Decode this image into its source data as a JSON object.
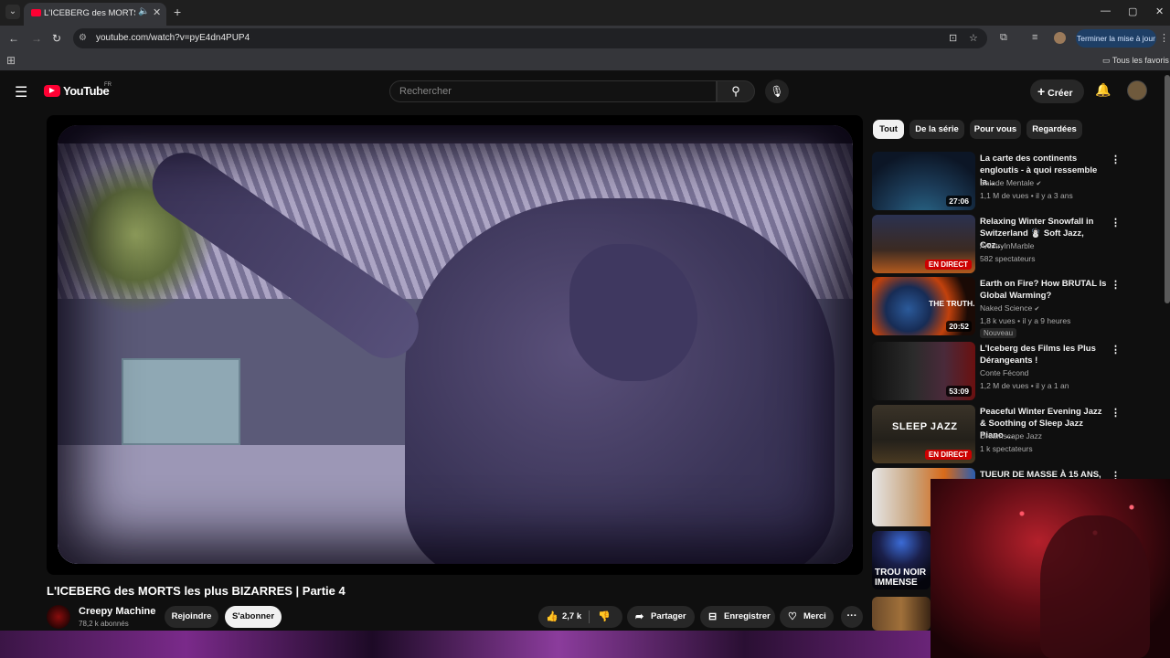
{
  "browser": {
    "tab_title": "L'ICEBERG des MORTS les p",
    "url": "youtube.com/watch?v=pyE4dn4PUP4",
    "update_button": "Terminer la mise à jour",
    "bookmarks_folder": "Tous les favoris"
  },
  "header": {
    "wordmark": "YouTube",
    "country": "FR",
    "search_placeholder": "Rechercher",
    "create_label": "Créer"
  },
  "video": {
    "title": "L'ICEBERG des MORTS les plus BIZARRES | Partie 4",
    "channel": "Creepy Machine",
    "subscribers": "78,2 k abonnés",
    "join_label": "Rejoindre",
    "subscribe_label": "S'abonner",
    "likes": "2,7 k",
    "share_label": "Partager",
    "save_label": "Enregistrer",
    "thanks_label": "Merci"
  },
  "chips": [
    "Tout",
    "De la série",
    "Pour vous",
    "Regardées"
  ],
  "recommendations": [
    {
      "title": "La carte des continents engloutis - à quoi ressemble la...",
      "channel": "Balade Mentale",
      "verified": true,
      "meta": "1,1 M de vues • il y a 3 ans",
      "duration": "27:06"
    },
    {
      "title": "Relaxing Winter Snowfall in Switzerland ☃️ Soft Jazz, Coz...",
      "channel": "ArtistryInMarble",
      "verified": false,
      "meta": "582 spectateurs",
      "live": "EN DIRECT"
    },
    {
      "title": "Earth on Fire? How BRUTAL Is Global Warming?",
      "channel": "Naked Science",
      "verified": true,
      "meta": "1,8 k vues • il y a 9 heures",
      "duration": "20:52",
      "badge": "Nouveau",
      "thumb_text": "THE TRUTH."
    },
    {
      "title": "L'Iceberg des Films les Plus Dérangeants !",
      "channel": "Conte Fécond",
      "verified": false,
      "meta": "1,2 M de vues • il y a 1 an",
      "duration": "53:09"
    },
    {
      "title": "Peaceful Winter Evening Jazz & Soothing of Sleep Jazz Piano ...",
      "channel": "Dreamscape Jazz",
      "verified": false,
      "meta": "1 k spectateurs",
      "live": "EN DIRECT",
      "thumb_text": "SLEEP JAZZ"
    },
    {
      "title": "TUEUR DE MASSE À 15 ANS,",
      "channel": "",
      "verified": false,
      "meta": ""
    }
  ],
  "extra_thumb_text": "TROU NOIR IMMENSE"
}
